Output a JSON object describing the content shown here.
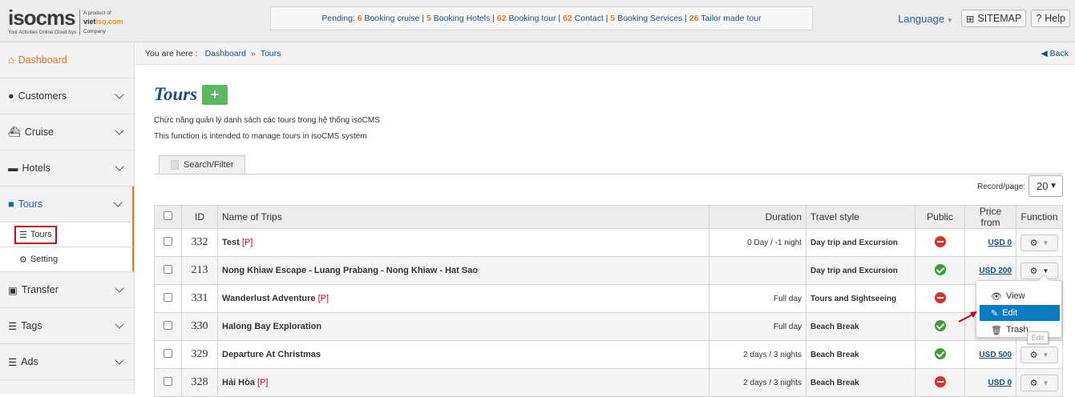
{
  "logo": {
    "brand": "isocms",
    "tagline": "Your Activities Online Cloud Sys",
    "product_of": "A product of",
    "company_brand_1": "viet",
    "company_brand_2": "iso.com",
    "company": "Company"
  },
  "pending": {
    "label": "Pending:",
    "items": [
      {
        "count": "6",
        "label": "Booking cruise"
      },
      {
        "count": "5",
        "label": "Booking Hotels"
      },
      {
        "count": "62",
        "label": "Booking tour"
      },
      {
        "count": "62",
        "label": "Contact"
      },
      {
        "count": "5",
        "label": "Booking Services"
      },
      {
        "count": "26",
        "label": "Tailor made tour"
      }
    ]
  },
  "header": {
    "language": "Language",
    "sitemap": "SITEMAP",
    "help": "Help"
  },
  "sidebar": {
    "dashboard": "Dashboard",
    "customers": "Customers",
    "cruise": "Cruise",
    "hotels": "Hotels",
    "tours": "Tours",
    "sub_tours": "Tours",
    "sub_setting": "Setting",
    "transfer": "Transfer",
    "tags": "Tags",
    "ads": "Ads"
  },
  "breadcrumb": {
    "prefix": "You are here :",
    "home": "Dashboard",
    "sep": "»",
    "current": "Tours",
    "back": "Back"
  },
  "page": {
    "title": "Tours",
    "add": "+",
    "desc_vi": "Chức năng quản lý danh sách các tours trong hệ thống isoCMS",
    "desc_en": "This function is intended to manage tours in isoCMS system",
    "search_tab": "Search/Filter",
    "record_label": "Record/page:",
    "record_value": "20"
  },
  "table": {
    "headers": {
      "id": "ID",
      "name": "Name of Trips",
      "duration": "Duration",
      "style": "Travel style",
      "public": "Public",
      "price": "Price from",
      "function": "Function"
    },
    "rows": [
      {
        "id": "332",
        "name": "Test",
        "flag": "[P]",
        "duration": "0 Day / -1 night",
        "style": "Day trip and Excursion",
        "public": false,
        "price": "USD 0"
      },
      {
        "id": "213",
        "name": "Nong Khiaw Escape - Luang Prabang - Nong Khiaw - Hat Sao",
        "flag": "",
        "duration": "",
        "style": "Day trip and Excursion",
        "public": true,
        "price": "USD 200"
      },
      {
        "id": "331",
        "name": "Wanderlust Adventure",
        "flag": "[P]",
        "duration": "Full day",
        "style": "Tours and Sightseeing",
        "public": false,
        "price": ""
      },
      {
        "id": "330",
        "name": "Halong Bay Exploration",
        "flag": "",
        "duration": "Full day",
        "style": "Beach Break",
        "public": true,
        "price": ""
      },
      {
        "id": "329",
        "name": "Departure At Christmas",
        "flag": "",
        "duration": "2 days / 3 nights",
        "style": "Beach Break",
        "public": true,
        "price": "USD 500"
      },
      {
        "id": "328",
        "name": "Hải Hòa",
        "flag": "[P]",
        "duration": "2 days / 3 nights",
        "style": "Beach Break",
        "public": false,
        "price": "USD 0"
      }
    ]
  },
  "menu": {
    "view": "View",
    "edit": "Edit",
    "trash": "Trash",
    "tooltip": "Edit"
  }
}
